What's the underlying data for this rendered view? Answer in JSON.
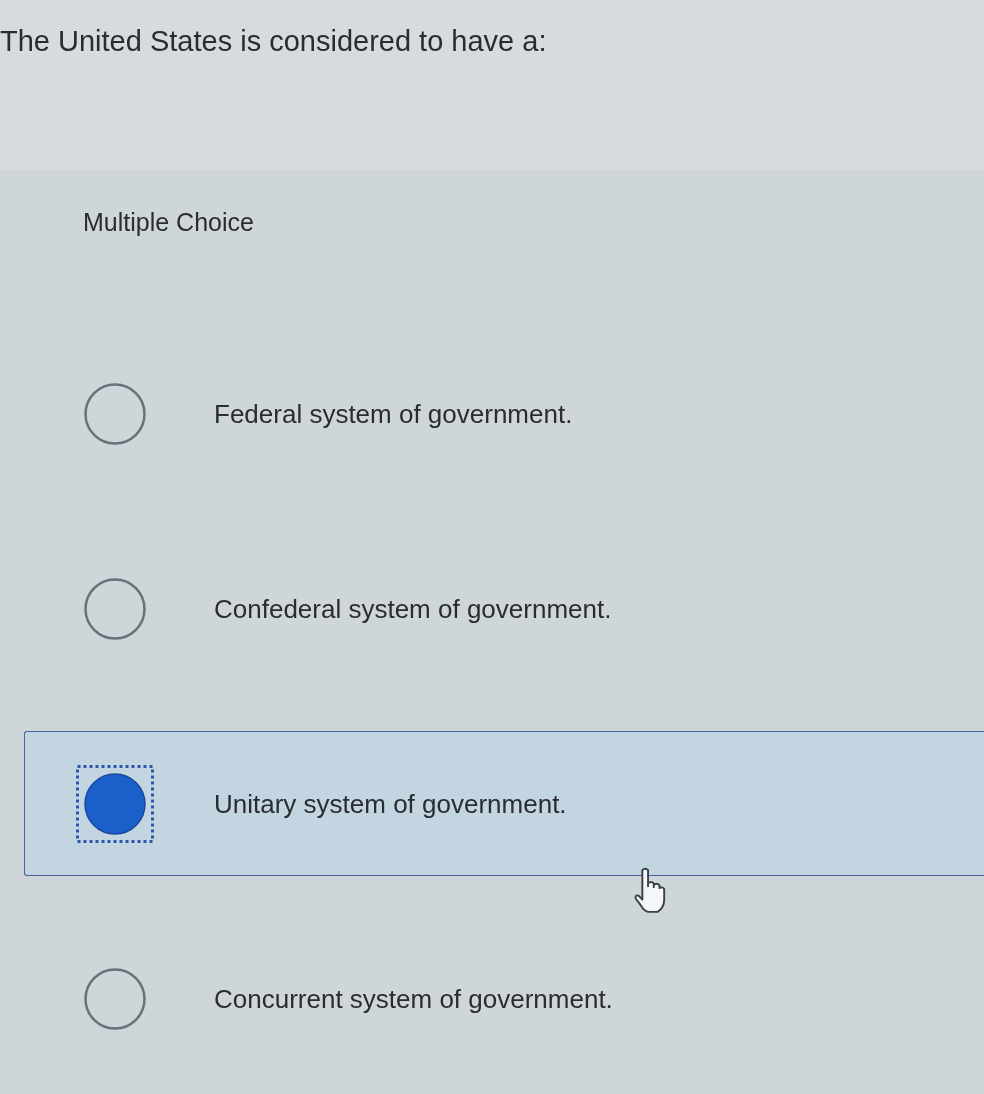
{
  "question": "The United States is considered to have a:",
  "question_type": "Multiple Choice",
  "options": [
    {
      "label": "Federal system of government.",
      "selected": false,
      "focused": false
    },
    {
      "label": "Confederal system of government.",
      "selected": false,
      "focused": false
    },
    {
      "label": "Unitary system of government.",
      "selected": true,
      "focused": true
    },
    {
      "label": "Concurrent system of government.",
      "selected": false,
      "focused": false
    }
  ]
}
